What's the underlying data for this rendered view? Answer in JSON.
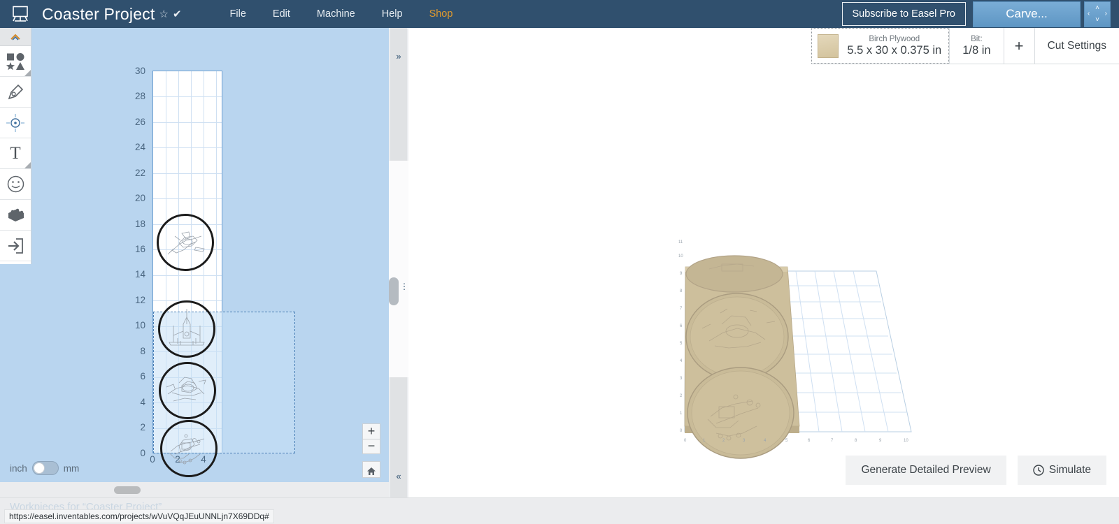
{
  "header": {
    "logo_icon": "easel-logo-icon",
    "project_title": "Coaster Project",
    "star_glyph": "☆",
    "check_glyph": "✔",
    "menu": [
      {
        "label": "File"
      },
      {
        "label": "Edit"
      },
      {
        "label": "Machine"
      },
      {
        "label": "Help"
      },
      {
        "label": "Shop"
      }
    ],
    "subscribe_label": "Subscribe to Easel Pro",
    "carve_label": "Carve...",
    "dpad": {
      "up": "˄",
      "down": "˅",
      "left": "‹",
      "right": "›"
    },
    "bg_color": "#30506e",
    "accent_color": "#e09a2e",
    "carve_color": "#6ba2cd"
  },
  "toolbar": {
    "collapse_glyph": "˄",
    "items": [
      {
        "name": "shapes-tool",
        "label": "Shapes"
      },
      {
        "name": "pen-tool",
        "label": "Pen"
      },
      {
        "name": "center-tool",
        "label": "Center"
      },
      {
        "name": "text-tool",
        "label": "T"
      },
      {
        "name": "emoji-tool",
        "label": "Emoji"
      },
      {
        "name": "apps-tool",
        "label": "Apps"
      },
      {
        "name": "import-tool",
        "label": "Import"
      }
    ]
  },
  "canvas": {
    "units_left": "inch",
    "units_right": "mm",
    "units_selected": "inch",
    "y_ticks": [
      "30",
      "28",
      "26",
      "24",
      "22",
      "20",
      "18",
      "16",
      "14",
      "12",
      "10",
      "8",
      "6",
      "4",
      "2",
      "0"
    ],
    "x_ticks": [
      "0",
      "2",
      "4"
    ],
    "zoom_in": "+",
    "zoom_out": "−",
    "home_icon": "home-icon",
    "board_color": "#ffffff",
    "grid_color": "#cfe0f2",
    "background_color": "#b9d5ef",
    "shapes": [
      {
        "name": "coaster-1",
        "art": "spaceship-line-art"
      },
      {
        "name": "coaster-2",
        "art": "x-wing-line-art"
      },
      {
        "name": "coaster-3",
        "art": "spaceship-line-art"
      },
      {
        "name": "coaster-4",
        "art": "speeder-line-art"
      }
    ]
  },
  "divider": {
    "expand_right_glyph": "»",
    "expand_left_glyph": "«",
    "drag_dots": "⋮"
  },
  "material_bar": {
    "material_name": "Birch Plywood",
    "material_size": "5.5 x 30 x 0.375 in",
    "bit_label": "Bit:",
    "bit_value": "1/8 in",
    "add_label": "+",
    "cut_settings_label": "Cut Settings",
    "swatch_color": "#ddd0b0"
  },
  "preview": {
    "generate_label": "Generate Detailed Preview",
    "simulate_label": "Simulate",
    "simulate_icon": "clock-icon",
    "board_color": "#cdbf9c",
    "grid_color": "#cfe0f2",
    "x_ticks": [
      "0",
      "1",
      "2",
      "3",
      "4",
      "5",
      "6",
      "7",
      "8",
      "9",
      "10"
    ],
    "y_ticks": [
      "0",
      "1",
      "2",
      "3",
      "4",
      "5",
      "6",
      "7",
      "8",
      "9",
      "10",
      "11"
    ]
  },
  "status_bar": {
    "workpieces_text": "Workpieces for “Coaster Project”",
    "url": "https://easel.inventables.com/projects/wVuVQqJEuUNNLjn7X69DDq#"
  }
}
